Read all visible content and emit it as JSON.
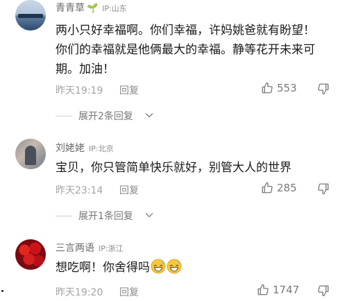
{
  "comments": [
    {
      "username": "青青草",
      "has_sprout": true,
      "ip": "IP:山东",
      "text": "两小只好幸福啊。你们幸福，许妈姚爸就有盼望！你们的幸福就是他俩最大的幸福。静等花开未来可期。加油！",
      "time": "昨天19:19",
      "reply_label": "回复",
      "likes": "553",
      "expand_label": "展开2条回复"
    },
    {
      "username": "刘姥姥",
      "has_sprout": false,
      "ip": "IP:北京",
      "text": "宝贝，你只管简单快乐就好，别管大人的世界",
      "time": "昨天23:14",
      "reply_label": "回复",
      "likes": "285",
      "expand_label": "展开1条回复"
    },
    {
      "username": "三言两语",
      "has_sprout": false,
      "ip": "IP:浙江",
      "text": "想吃啊！你舍得吗",
      "emoji": [
        "grinning-sweat-emoji",
        "grinning-sweat-emoji"
      ],
      "time": "昨天19:20",
      "reply_label": "回复",
      "likes": "1747"
    }
  ],
  "icons": {
    "sprout": "seedling-icon",
    "like": "thumbs-up-icon",
    "dislike": "thumbs-down-icon",
    "chevron": "chevron-down-icon"
  },
  "colors": {
    "meta_gray": "#a3a3a3",
    "sprout_green": "#3fae3f"
  }
}
